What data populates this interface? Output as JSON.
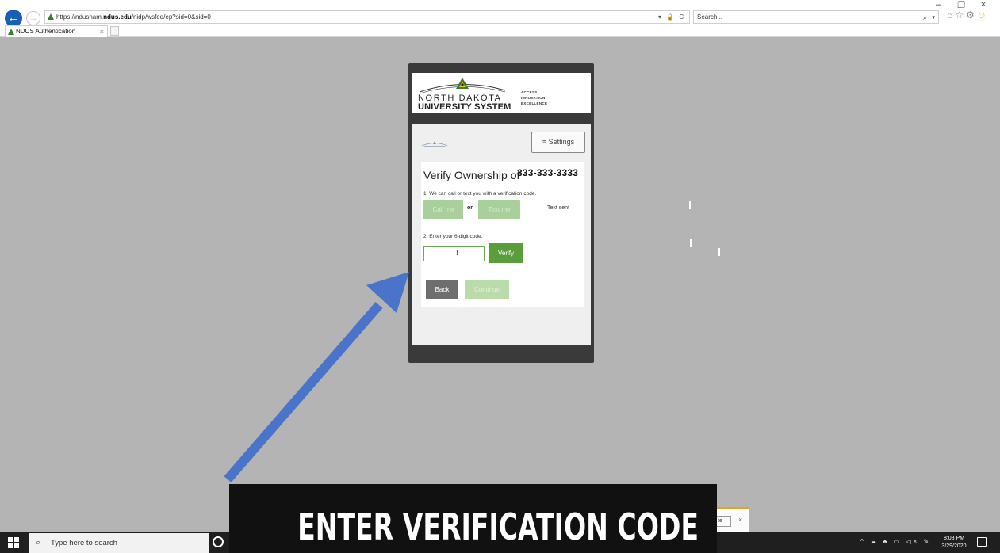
{
  "browser": {
    "url_prefix": "https://ndusnam.",
    "url_host": "ndus.edu",
    "url_path": "/nidp/wsfed/ep?sid=0&sid=0",
    "addr_tools": "▾ 🔒 C",
    "search_placeholder": "Search...",
    "tab_title": "NDUS Authentication",
    "tab_close": "×",
    "back_glyph": "←",
    "forward_glyph": "→",
    "search_glyph": "⌕",
    "dropdown_glyph": "▾",
    "home_glyph": "⌂",
    "star_glyph": "☆",
    "gear_glyph": "⚙",
    "emoji_glyph": "☺",
    "minimize_glyph": "–",
    "restore_glyph": "❐",
    "close_glyph": "×"
  },
  "logo": {
    "line1": "NORTH DAKOTA",
    "line2": "UNIVERSITY SYSTEM",
    "tag1": "ACCESS",
    "tag2": "INNOVATION",
    "tag3": "EXCELLENCE",
    "brand_green": "#3b7d2e"
  },
  "mfa": {
    "settings_label": "≡  Settings",
    "title": "Verify Ownership of",
    "phone": "333-333-3333",
    "step1": "1. We can call or text you with a verification code.",
    "call_label": "Call me",
    "or_label": "or",
    "text_label": "Text me",
    "text_sent": "Text sent",
    "step2": "2. Enter your 6-digit code.",
    "code_value": "",
    "cursor_glyph": "I",
    "verify_label": "Verify",
    "back_label": "Back",
    "continue_label": "Continue",
    "verify_green": "#5a9e3c"
  },
  "caption": {
    "text": "ENTER VERIFICATION CODE",
    "arrow_color": "#4a74c9"
  },
  "popup": {
    "button_label": "te",
    "close": "×"
  },
  "taskbar": {
    "search_placeholder": "Type here to search",
    "search_glyph": "⌕",
    "time": "8:08 PM",
    "date": "3/29/2020",
    "tray_glyphs": "^ ☁ ♣ ▭ ◁× ✎"
  }
}
